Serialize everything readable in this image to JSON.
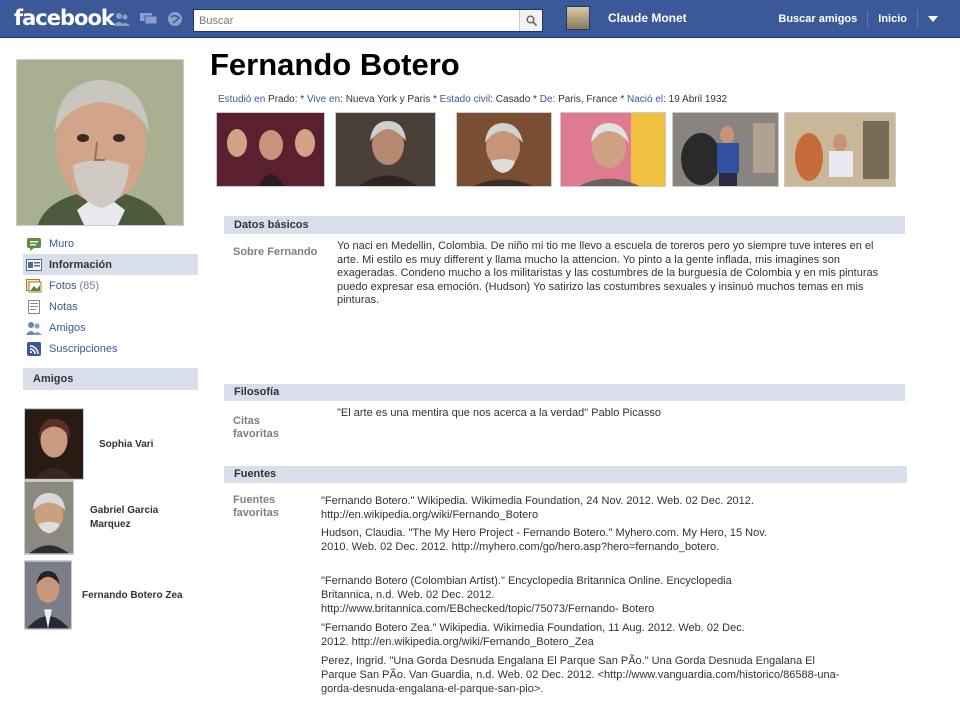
{
  "topbar": {
    "logo": "facebook",
    "search_placeholder": "Buscar",
    "user_name": "Claude Monet",
    "find_friends": "Buscar amigos",
    "home": "Inicio"
  },
  "profile": {
    "name": "Fernando Botero",
    "info": {
      "studied_label": "Estudió en",
      "studied_value": " Prado: * ",
      "lives_label": "Vive en",
      "lives_value": ": Nueva York y Paris * ",
      "civil_label": "Estado civil",
      "civil_value": ": Casado * ",
      "from_label": "De",
      "from_value": ": Paris, France * ",
      "born_label": "Nació el",
      "born_value": ": 19 Abril 1932"
    }
  },
  "leftnav": [
    {
      "label": "Muro",
      "icon": "wall-icon"
    },
    {
      "label": "Información",
      "icon": "info-icon"
    },
    {
      "label": "Fotos",
      "count": "(85)",
      "icon": "photos-icon"
    },
    {
      "label": "Notas",
      "icon": "notes-icon"
    },
    {
      "label": "Amigos",
      "icon": "friends-icon"
    },
    {
      "label": "Suscripciones",
      "icon": "subscriptions-icon"
    }
  ],
  "friends": {
    "heading": "Amigos",
    "list": [
      "Sophia Vari",
      "Gabriel Garcia Marquez",
      "Fernando Botero Zea"
    ]
  },
  "sections": {
    "basic": {
      "heading": "Datos básicos",
      "label": "Sobre Fernando",
      "text": "Yo naci en Medellin, Colombia. De niño mi tio me llevo a escuela de toreros pero yo siempre tuve interes en el arte. Mi estilo es muy different y llama mucho la attencion. Yo pinto a la gente inflada, mis imagines son exageradas. Condeno mucho a los militaristas y las costumbres de la burguesía de Colombia y en mis pinturas puedo expresar esa emoción. (Hudson) Yo satirizo las costumbres sexuales y insinuó muchos temas en mis pinturas."
    },
    "philosophy": {
      "heading": "Filosofía",
      "label": "Citas favoritas",
      "text": "\"El arte es una mentira que nos acerca a la verdad\" Pablo Picasso"
    },
    "sources": {
      "heading": "Fuentes",
      "label": "Fuentes favoritas",
      "items": [
        "\"Fernando Botero.\" Wikipedia. Wikimedia Foundation, 24 Nov. 2012. Web. 02 Dec. 2012. http://en.wikipedia.org/wiki/Fernando_Botero",
        "Hudson, Claudia. \"The My Hero Project - Fernando Botero.\" Myhero.com. My Hero, 15 Nov. 2010. Web. 02 Dec. 2012. http://myhero.com/go/hero.asp?hero=fernando_botero.",
        "\"Fernando Botero (Colombian Artist).\" Encyclopedia Britannica Online. Encyclopedia Britannica, n.d. Web. 02 Dec. 2012. http://www.britannica.com/EBchecked/topic/75073/Fernando- Botero",
        "\"Fernando Botero Zea.\" Wikipedia. Wikimedia Foundation, 11 Aug. 2012. Web. 02 Dec. 2012. http://en.wikipedia.org/wiki/Fernando_Botero_Zea",
        "Perez, Ingrid. \"Una Gorda Desnuda Engalana El Parque San PÃo.\" Una Gorda Desnuda Engalana El Parque San PÃo. Van Guardia, n.d. Web. 02 Dec. 2012. <http://www.vanguardia.com/historico/86588-una-gorda-desnuda-engalana-el-parque-san-pio>."
      ]
    }
  },
  "colors": {
    "brand": "#3b5998",
    "section_bg": "#d8dfea",
    "label_grey": "#7f7f7f"
  }
}
